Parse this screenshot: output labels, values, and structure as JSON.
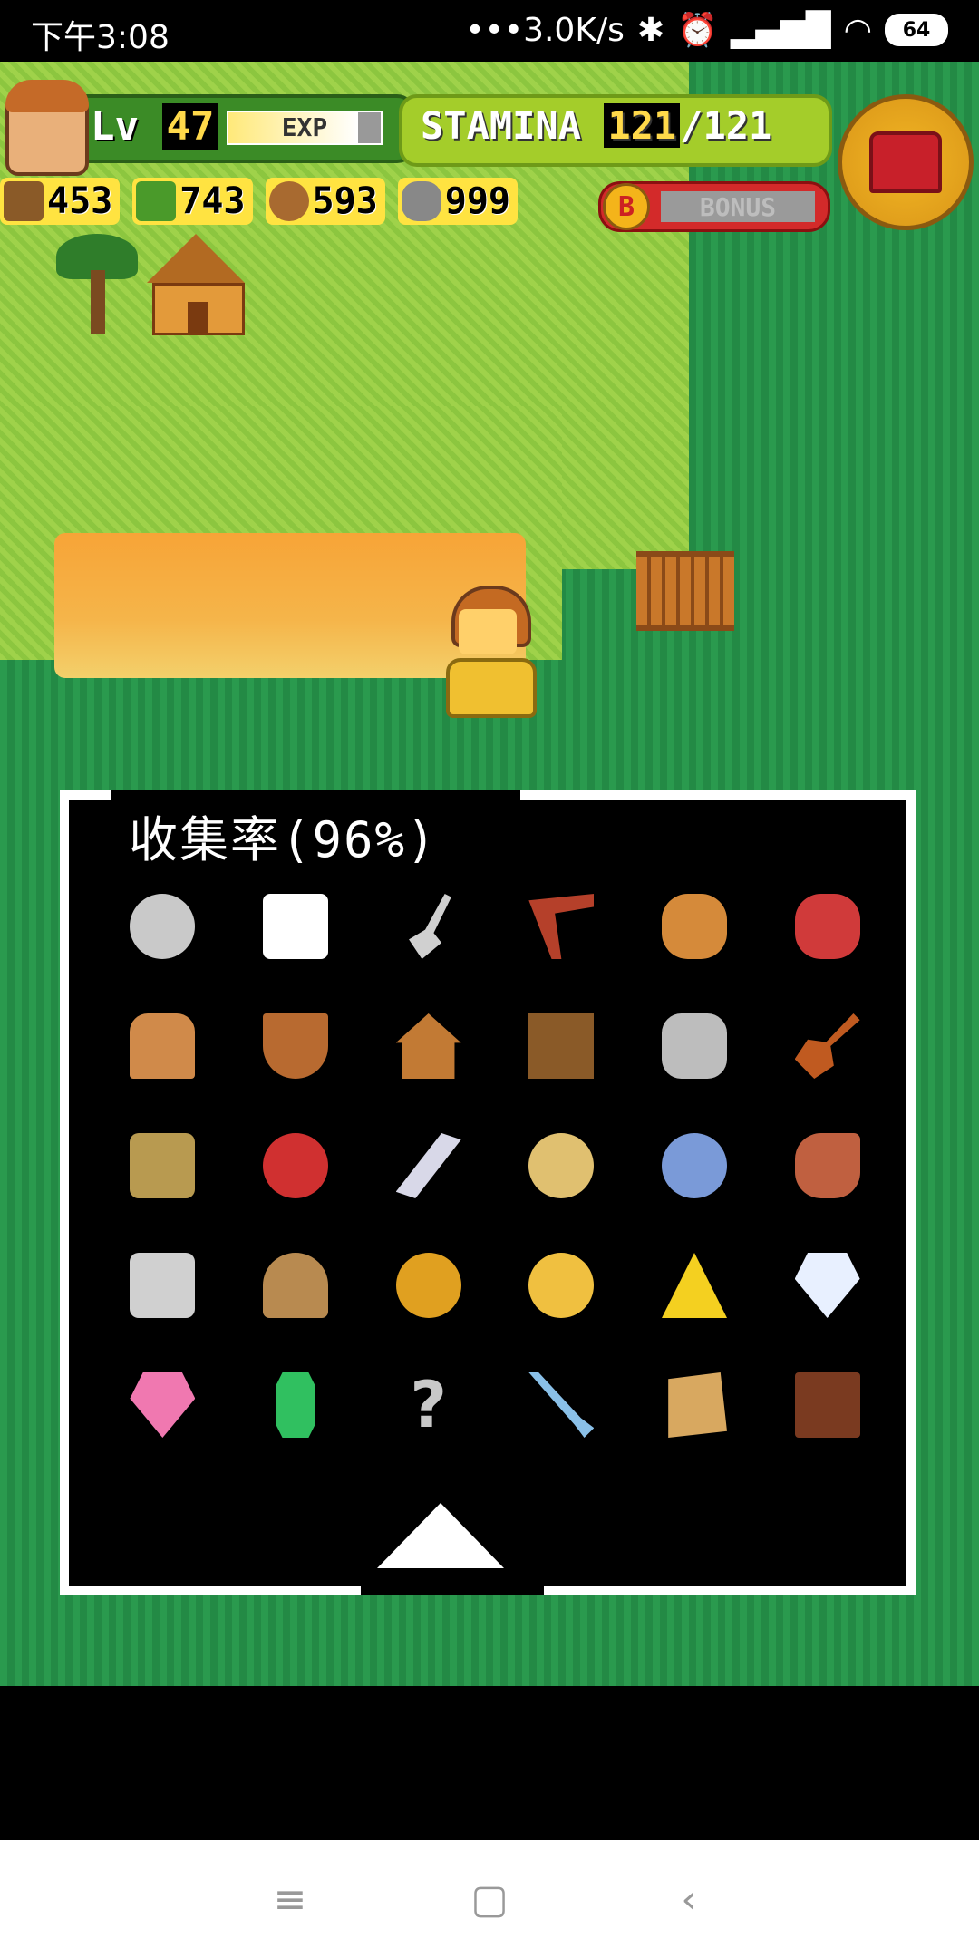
{
  "status_bar": {
    "time": "下午3:08",
    "network_speed": "•••3.0K/s",
    "battery": "64"
  },
  "hud": {
    "level_label": "Lv",
    "level": "47",
    "exp_label": "EXP",
    "exp_fill": 0.85,
    "stamina_label": "STAMINA",
    "stamina_current": "121",
    "stamina_max": "/121",
    "resources": [
      {
        "icon": "branch-icon",
        "value": "453"
      },
      {
        "icon": "leaf-icon",
        "value": "743"
      },
      {
        "icon": "nut-icon",
        "value": "593"
      },
      {
        "icon": "stone-icon",
        "value": "999"
      }
    ],
    "bonus_coin": "B",
    "bonus_label": "BONUS"
  },
  "collection": {
    "title": "收集率(96%)",
    "items": [
      {
        "name": "compass-icon",
        "color": "#c9c9c9"
      },
      {
        "name": "dice-icon",
        "color": "#ffffff"
      },
      {
        "name": "shovel-icon",
        "color": "#d0d0d0"
      },
      {
        "name": "boomerang-icon",
        "color": "#b5402a"
      },
      {
        "name": "net-icon",
        "color": "#d58a3a"
      },
      {
        "name": "red-net-icon",
        "color": "#d03a3a"
      },
      {
        "name": "logs-icon",
        "color": "#d08a4a"
      },
      {
        "name": "boat-icon",
        "color": "#b86a30"
      },
      {
        "name": "hut-icon",
        "color": "#c27a34"
      },
      {
        "name": "fence-icon",
        "color": "#8a5a28"
      },
      {
        "name": "backpack-icon",
        "color": "#bdbdbd"
      },
      {
        "name": "guitar-icon",
        "color": "#c05a20"
      },
      {
        "name": "tv-icon",
        "color": "#b89a50"
      },
      {
        "name": "bicycle-icon",
        "color": "#d03030"
      },
      {
        "name": "comb-icon",
        "color": "#d8d8e8"
      },
      {
        "name": "hand-mirror-icon",
        "color": "#e0c070"
      },
      {
        "name": "magnifier-icon",
        "color": "#7a9ad8"
      },
      {
        "name": "vacuum-icon",
        "color": "#c06040"
      },
      {
        "name": "camera-icon",
        "color": "#d0d0d0"
      },
      {
        "name": "hat-icon",
        "color": "#b88a50"
      },
      {
        "name": "ring-icon",
        "color": "#e0a020"
      },
      {
        "name": "gold-nugget-icon",
        "color": "#f0c040"
      },
      {
        "name": "gold-pile-icon",
        "color": "#f4d020"
      },
      {
        "name": "diamond-icon",
        "color": "#e8f0ff"
      },
      {
        "name": "ruby-icon",
        "color": "#f078b0"
      },
      {
        "name": "emerald-icon",
        "color": "#30c060"
      },
      {
        "name": "unknown-icon",
        "color": "#c8c8c8"
      },
      {
        "name": "sword-icon",
        "color": "#8ac0e8"
      },
      {
        "name": "map-scroll-icon",
        "color": "#d8a860"
      },
      {
        "name": "book-icon",
        "color": "#7a3a20"
      }
    ]
  }
}
